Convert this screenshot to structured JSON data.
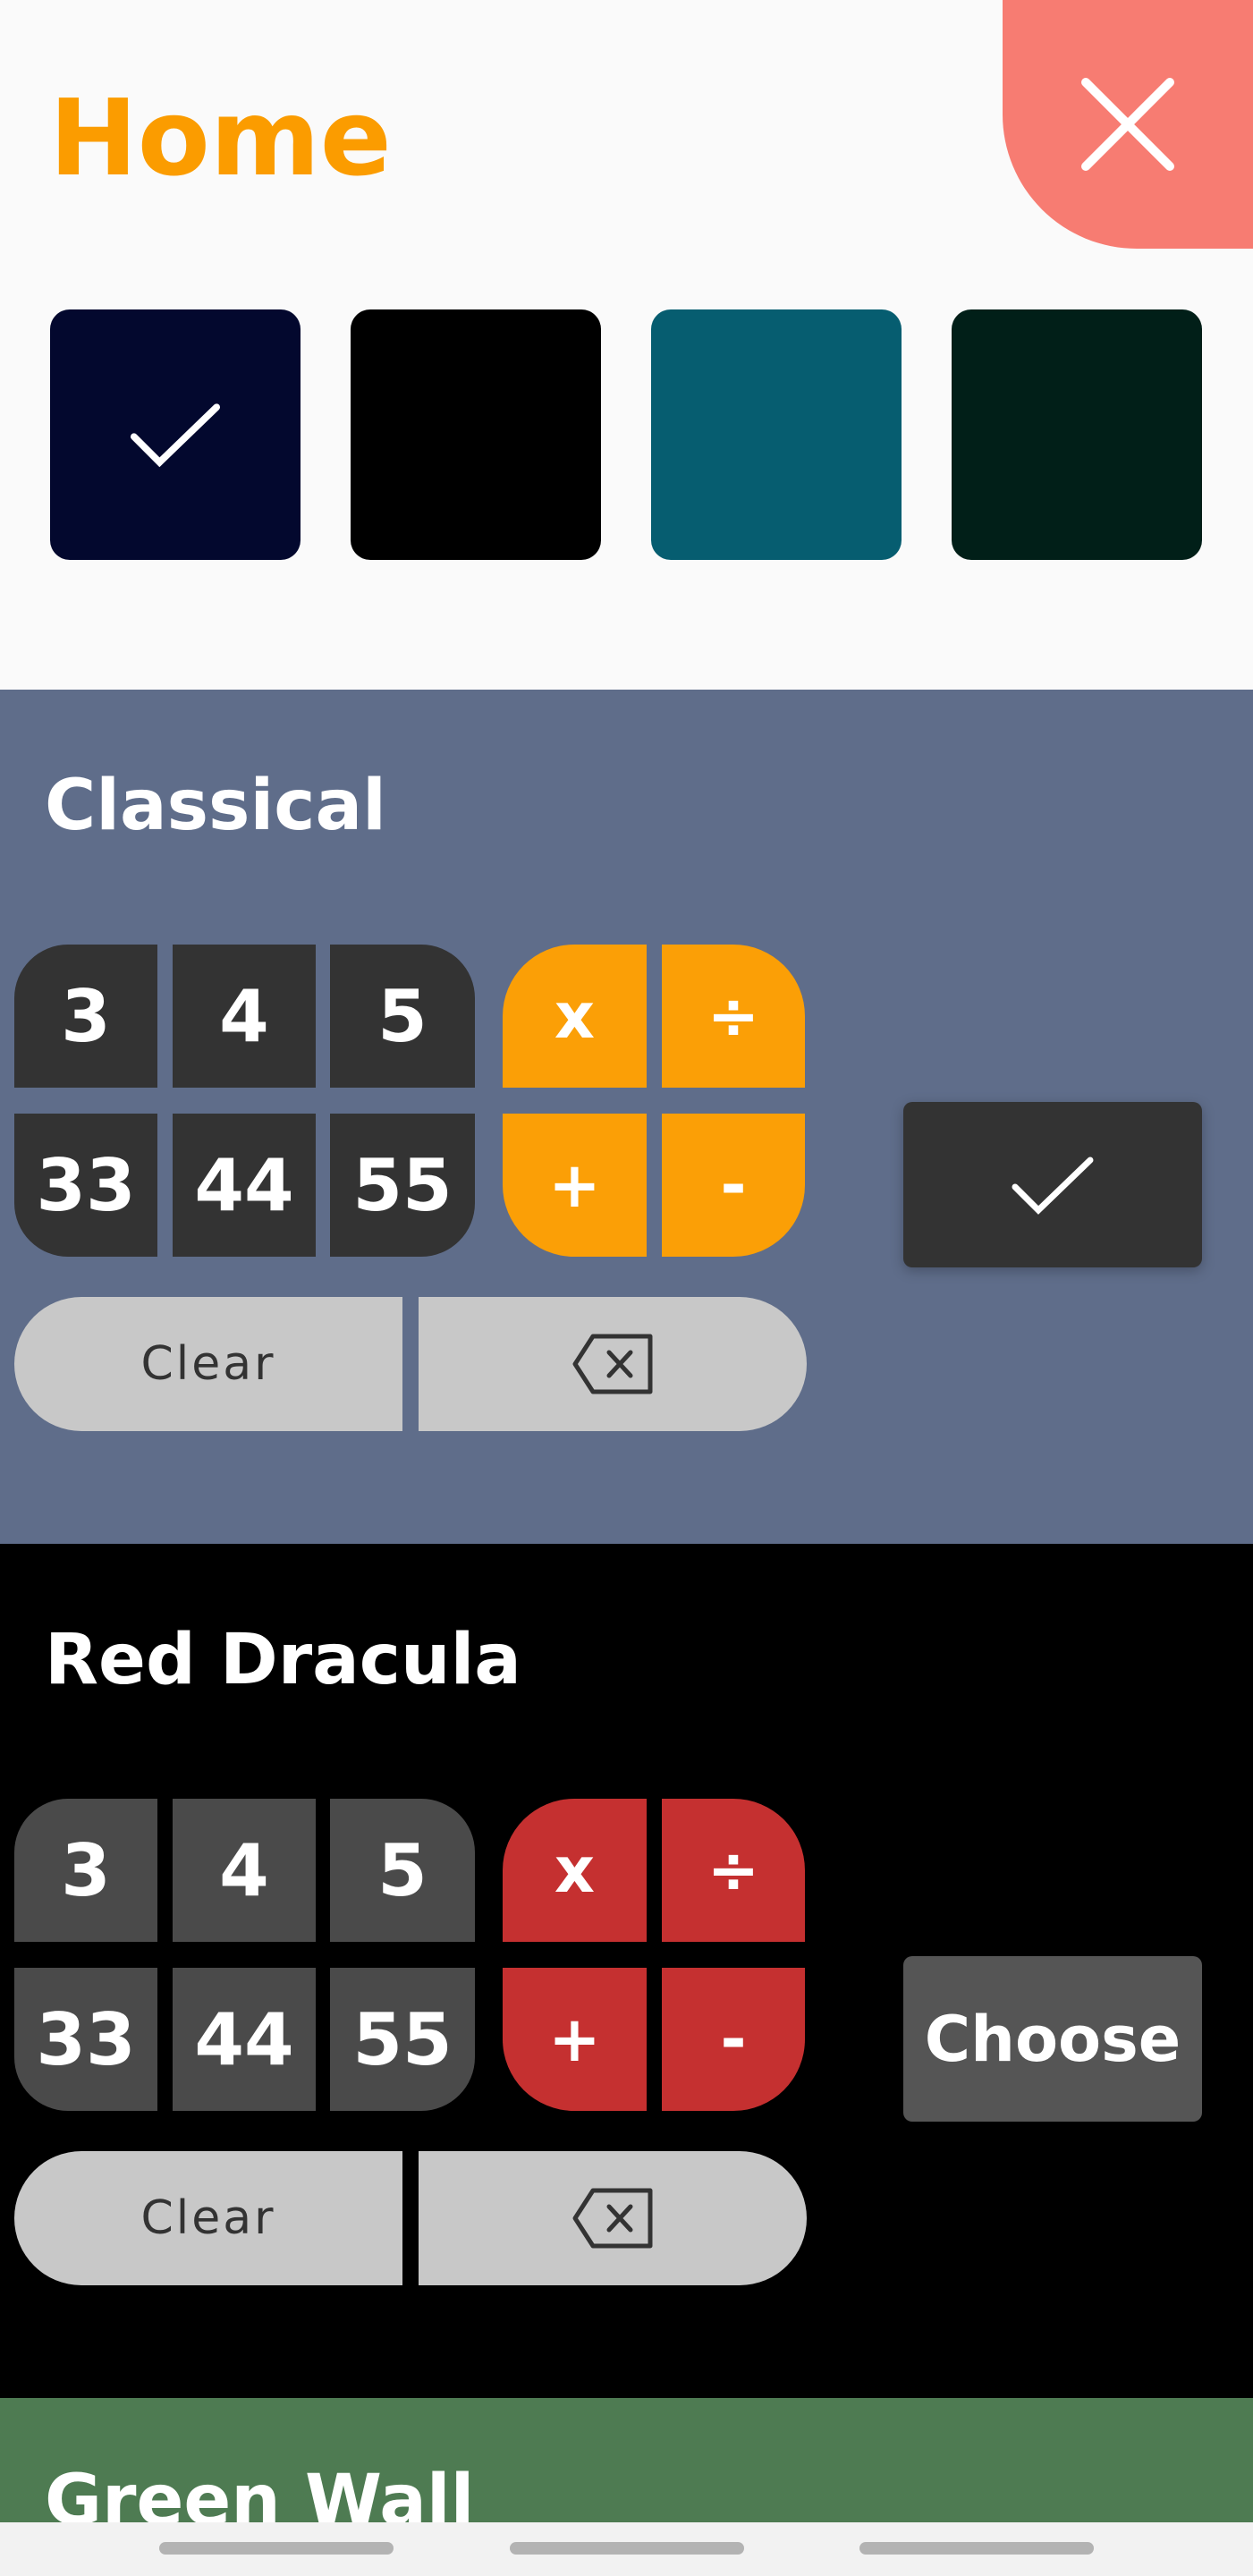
{
  "header": {
    "title": "Home",
    "close_icon": "close-icon"
  },
  "swatches": [
    {
      "color": "#03082e",
      "selected": true
    },
    {
      "color": "#000000",
      "selected": false
    },
    {
      "color": "#065d70",
      "selected": false
    },
    {
      "color": "#011f18",
      "selected": false
    }
  ],
  "themes": [
    {
      "name": "Classical",
      "bg": "#5f6d8a",
      "digit_bg": "#333333",
      "op_bg": "#fb9f06",
      "action": "check-icon",
      "action_label": "",
      "action_bg": "#333333",
      "digits": [
        "3",
        "4",
        "5",
        "33",
        "44",
        "55"
      ],
      "ops": [
        "x",
        "÷",
        "+",
        "-"
      ],
      "clear": "Clear"
    },
    {
      "name": "Red Dracula",
      "bg": "#000000",
      "digit_bg": "#4a4a4a",
      "op_bg": "#c53030",
      "action": "text",
      "action_label": "Choose",
      "action_bg": "#555555",
      "digits": [
        "3",
        "4",
        "5",
        "33",
        "44",
        "55"
      ],
      "ops": [
        "x",
        "÷",
        "+",
        "-"
      ],
      "clear": "Clear"
    },
    {
      "name": "Green Wall",
      "bg": "#4e7b52"
    }
  ]
}
